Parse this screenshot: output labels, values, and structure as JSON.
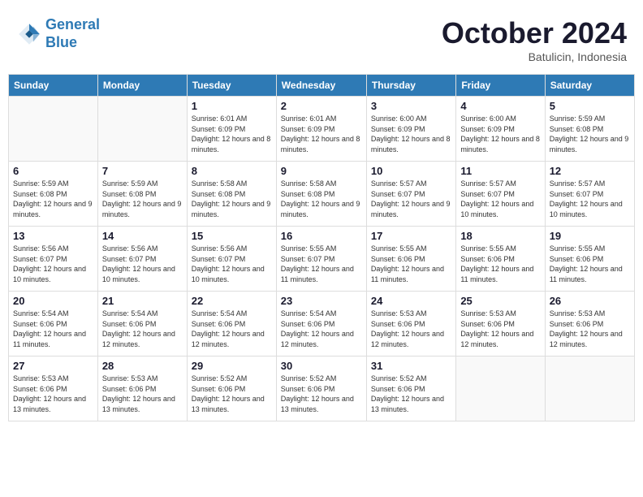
{
  "header": {
    "logo_line1": "General",
    "logo_line2": "Blue",
    "month": "October 2024",
    "location": "Batulicin, Indonesia"
  },
  "days_of_week": [
    "Sunday",
    "Monday",
    "Tuesday",
    "Wednesday",
    "Thursday",
    "Friday",
    "Saturday"
  ],
  "weeks": [
    [
      {
        "day": "",
        "info": ""
      },
      {
        "day": "",
        "info": ""
      },
      {
        "day": "1",
        "info": "Sunrise: 6:01 AM\nSunset: 6:09 PM\nDaylight: 12 hours and 8 minutes."
      },
      {
        "day": "2",
        "info": "Sunrise: 6:01 AM\nSunset: 6:09 PM\nDaylight: 12 hours and 8 minutes."
      },
      {
        "day": "3",
        "info": "Sunrise: 6:00 AM\nSunset: 6:09 PM\nDaylight: 12 hours and 8 minutes."
      },
      {
        "day": "4",
        "info": "Sunrise: 6:00 AM\nSunset: 6:09 PM\nDaylight: 12 hours and 8 minutes."
      },
      {
        "day": "5",
        "info": "Sunrise: 5:59 AM\nSunset: 6:08 PM\nDaylight: 12 hours and 9 minutes."
      }
    ],
    [
      {
        "day": "6",
        "info": "Sunrise: 5:59 AM\nSunset: 6:08 PM\nDaylight: 12 hours and 9 minutes."
      },
      {
        "day": "7",
        "info": "Sunrise: 5:59 AM\nSunset: 6:08 PM\nDaylight: 12 hours and 9 minutes."
      },
      {
        "day": "8",
        "info": "Sunrise: 5:58 AM\nSunset: 6:08 PM\nDaylight: 12 hours and 9 minutes."
      },
      {
        "day": "9",
        "info": "Sunrise: 5:58 AM\nSunset: 6:08 PM\nDaylight: 12 hours and 9 minutes."
      },
      {
        "day": "10",
        "info": "Sunrise: 5:57 AM\nSunset: 6:07 PM\nDaylight: 12 hours and 9 minutes."
      },
      {
        "day": "11",
        "info": "Sunrise: 5:57 AM\nSunset: 6:07 PM\nDaylight: 12 hours and 10 minutes."
      },
      {
        "day": "12",
        "info": "Sunrise: 5:57 AM\nSunset: 6:07 PM\nDaylight: 12 hours and 10 minutes."
      }
    ],
    [
      {
        "day": "13",
        "info": "Sunrise: 5:56 AM\nSunset: 6:07 PM\nDaylight: 12 hours and 10 minutes."
      },
      {
        "day": "14",
        "info": "Sunrise: 5:56 AM\nSunset: 6:07 PM\nDaylight: 12 hours and 10 minutes."
      },
      {
        "day": "15",
        "info": "Sunrise: 5:56 AM\nSunset: 6:07 PM\nDaylight: 12 hours and 10 minutes."
      },
      {
        "day": "16",
        "info": "Sunrise: 5:55 AM\nSunset: 6:07 PM\nDaylight: 12 hours and 11 minutes."
      },
      {
        "day": "17",
        "info": "Sunrise: 5:55 AM\nSunset: 6:06 PM\nDaylight: 12 hours and 11 minutes."
      },
      {
        "day": "18",
        "info": "Sunrise: 5:55 AM\nSunset: 6:06 PM\nDaylight: 12 hours and 11 minutes."
      },
      {
        "day": "19",
        "info": "Sunrise: 5:55 AM\nSunset: 6:06 PM\nDaylight: 12 hours and 11 minutes."
      }
    ],
    [
      {
        "day": "20",
        "info": "Sunrise: 5:54 AM\nSunset: 6:06 PM\nDaylight: 12 hours and 11 minutes."
      },
      {
        "day": "21",
        "info": "Sunrise: 5:54 AM\nSunset: 6:06 PM\nDaylight: 12 hours and 12 minutes."
      },
      {
        "day": "22",
        "info": "Sunrise: 5:54 AM\nSunset: 6:06 PM\nDaylight: 12 hours and 12 minutes."
      },
      {
        "day": "23",
        "info": "Sunrise: 5:54 AM\nSunset: 6:06 PM\nDaylight: 12 hours and 12 minutes."
      },
      {
        "day": "24",
        "info": "Sunrise: 5:53 AM\nSunset: 6:06 PM\nDaylight: 12 hours and 12 minutes."
      },
      {
        "day": "25",
        "info": "Sunrise: 5:53 AM\nSunset: 6:06 PM\nDaylight: 12 hours and 12 minutes."
      },
      {
        "day": "26",
        "info": "Sunrise: 5:53 AM\nSunset: 6:06 PM\nDaylight: 12 hours and 12 minutes."
      }
    ],
    [
      {
        "day": "27",
        "info": "Sunrise: 5:53 AM\nSunset: 6:06 PM\nDaylight: 12 hours and 13 minutes."
      },
      {
        "day": "28",
        "info": "Sunrise: 5:53 AM\nSunset: 6:06 PM\nDaylight: 12 hours and 13 minutes."
      },
      {
        "day": "29",
        "info": "Sunrise: 5:52 AM\nSunset: 6:06 PM\nDaylight: 12 hours and 13 minutes."
      },
      {
        "day": "30",
        "info": "Sunrise: 5:52 AM\nSunset: 6:06 PM\nDaylight: 12 hours and 13 minutes."
      },
      {
        "day": "31",
        "info": "Sunrise: 5:52 AM\nSunset: 6:06 PM\nDaylight: 12 hours and 13 minutes."
      },
      {
        "day": "",
        "info": ""
      },
      {
        "day": "",
        "info": ""
      }
    ]
  ]
}
